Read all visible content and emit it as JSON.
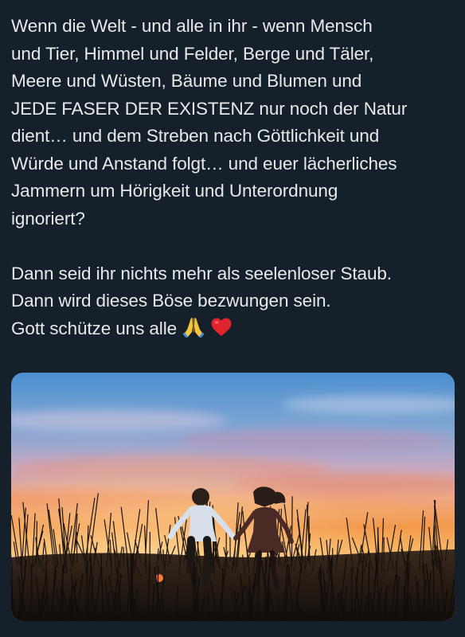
{
  "post": {
    "paragraph1": [
      "Wenn die Welt - und alle in ihr - wenn Mensch",
      "und Tier, Himmel und Felder, Berge und Täler,",
      "Meere und Wüsten, Bäume und Blumen und",
      "JEDE FASER DER EXISTENZ nur noch der Natur",
      "dient… und dem Streben nach Göttlichkeit und",
      "Würde und Anstand folgt… und euer lächerliches",
      "Jammern um Hörigkeit und Unterordnung",
      "ignoriert?"
    ],
    "paragraph2": [
      "Dann seid ihr nichts mehr als seelenloser Staub.",
      "Dann wird dieses Böse bezwungen sein.",
      "Gott schütze uns alle"
    ],
    "trailing_emojis": [
      "praying-hands-icon",
      "red-heart-icon"
    ]
  },
  "media": {
    "type": "photo",
    "colors": {
      "sky_top": "#4d8fcf",
      "sky_mid": "#9fb6d6",
      "glow_orange": "#f39a4d",
      "horizon": "#fde3b8",
      "silhouette": "#1a1410"
    }
  }
}
